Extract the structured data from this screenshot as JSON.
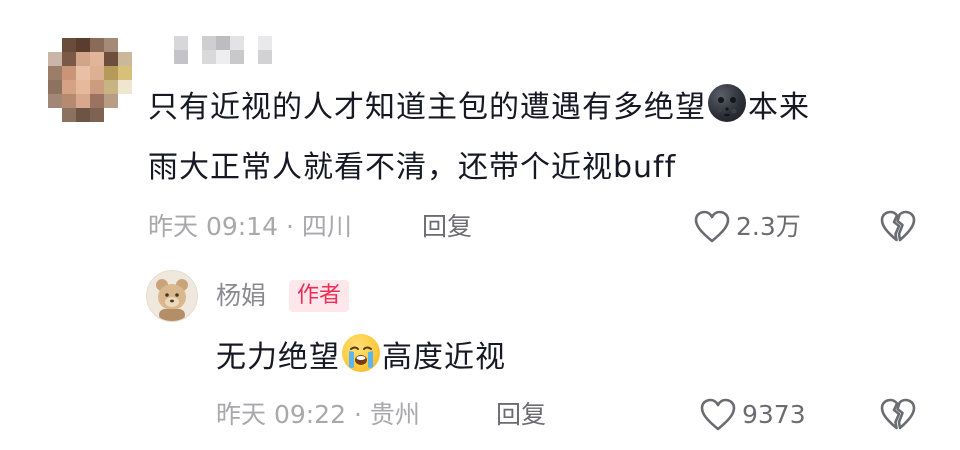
{
  "comment": {
    "text_line1_a": "只有近视的人才知道主包的遭遇有多绝望",
    "emoji1": "new-moon-face-emoji",
    "text_line1_b": "本来",
    "text_line2": "雨大正常人就看不清，还带个近视buff",
    "meta": "昨天 09:14 · 四川",
    "reply_label": "回复",
    "likes": "2.3万"
  },
  "reply": {
    "author": "杨娟",
    "badge": "作者",
    "text_a": "无力绝望",
    "emoji": "loudly-crying-face-emoji",
    "text_b": "高度近视",
    "meta": "昨天 09:22 · 贵州",
    "reply_label": "回复",
    "likes": "9373"
  },
  "colors": {
    "text_primary": "#161823",
    "meta_gray": "#a8a8ad",
    "action_gray": "#6b6b72",
    "badge_bg": "#fde7ec",
    "badge_text": "#f02d54"
  }
}
